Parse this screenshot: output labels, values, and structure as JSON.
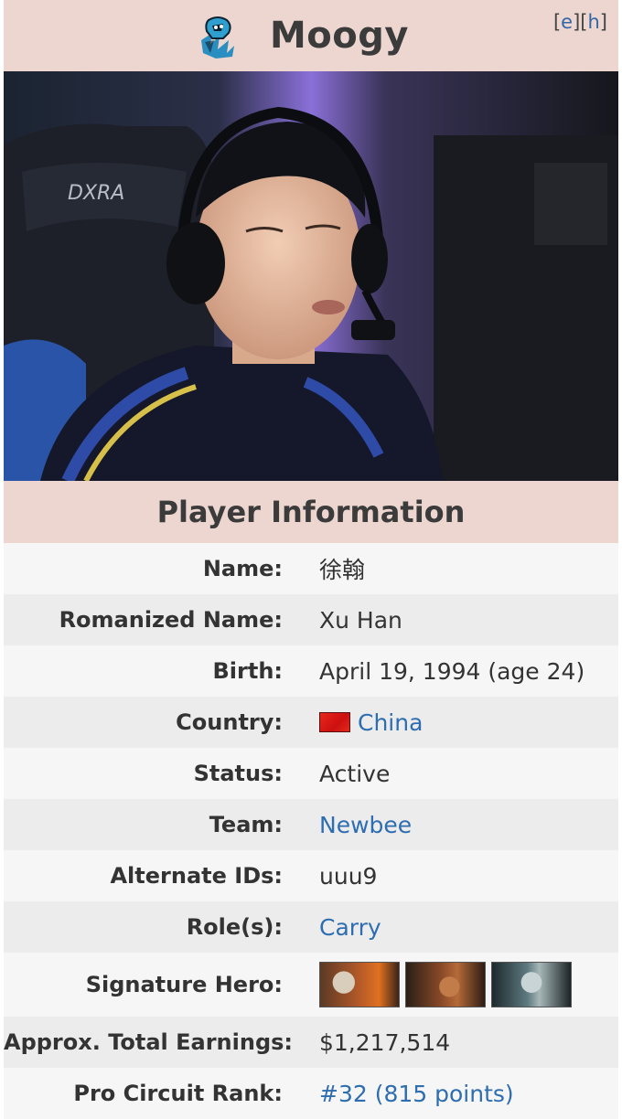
{
  "header": {
    "player_name": "Moogy",
    "edit_links": {
      "e": "e",
      "h": "h"
    }
  },
  "section_title": "Player Information",
  "info_rows": [
    {
      "label": "Name:",
      "value": "徐翰"
    },
    {
      "label": "Romanized Name:",
      "value": "Xu Han"
    },
    {
      "label": "Birth:",
      "value": "April 19, 1994 (age 24)"
    },
    {
      "label": "Country:",
      "value": "China",
      "icon": "china-flag-icon"
    },
    {
      "label": "Status:",
      "value": "Active"
    },
    {
      "label": "Team:",
      "value": "Newbee"
    },
    {
      "label": "Alternate IDs:",
      "value": "uuu9"
    },
    {
      "label": "Role(s):",
      "value": "Carry"
    },
    {
      "label": "Signature Hero:",
      "icons": [
        "hero-portrait-1",
        "hero-portrait-2",
        "hero-portrait-3"
      ]
    },
    {
      "label": "Approx. Total Earnings:",
      "value": "$1,217,514"
    },
    {
      "label": "Pro Circuit Rank:",
      "value": "#32 (815 points)"
    }
  ],
  "colors": {
    "header_bg": "#ecd6cf",
    "link": "#2d6db0",
    "row_light": "#f6f6f6",
    "row_dark": "#ececec"
  }
}
